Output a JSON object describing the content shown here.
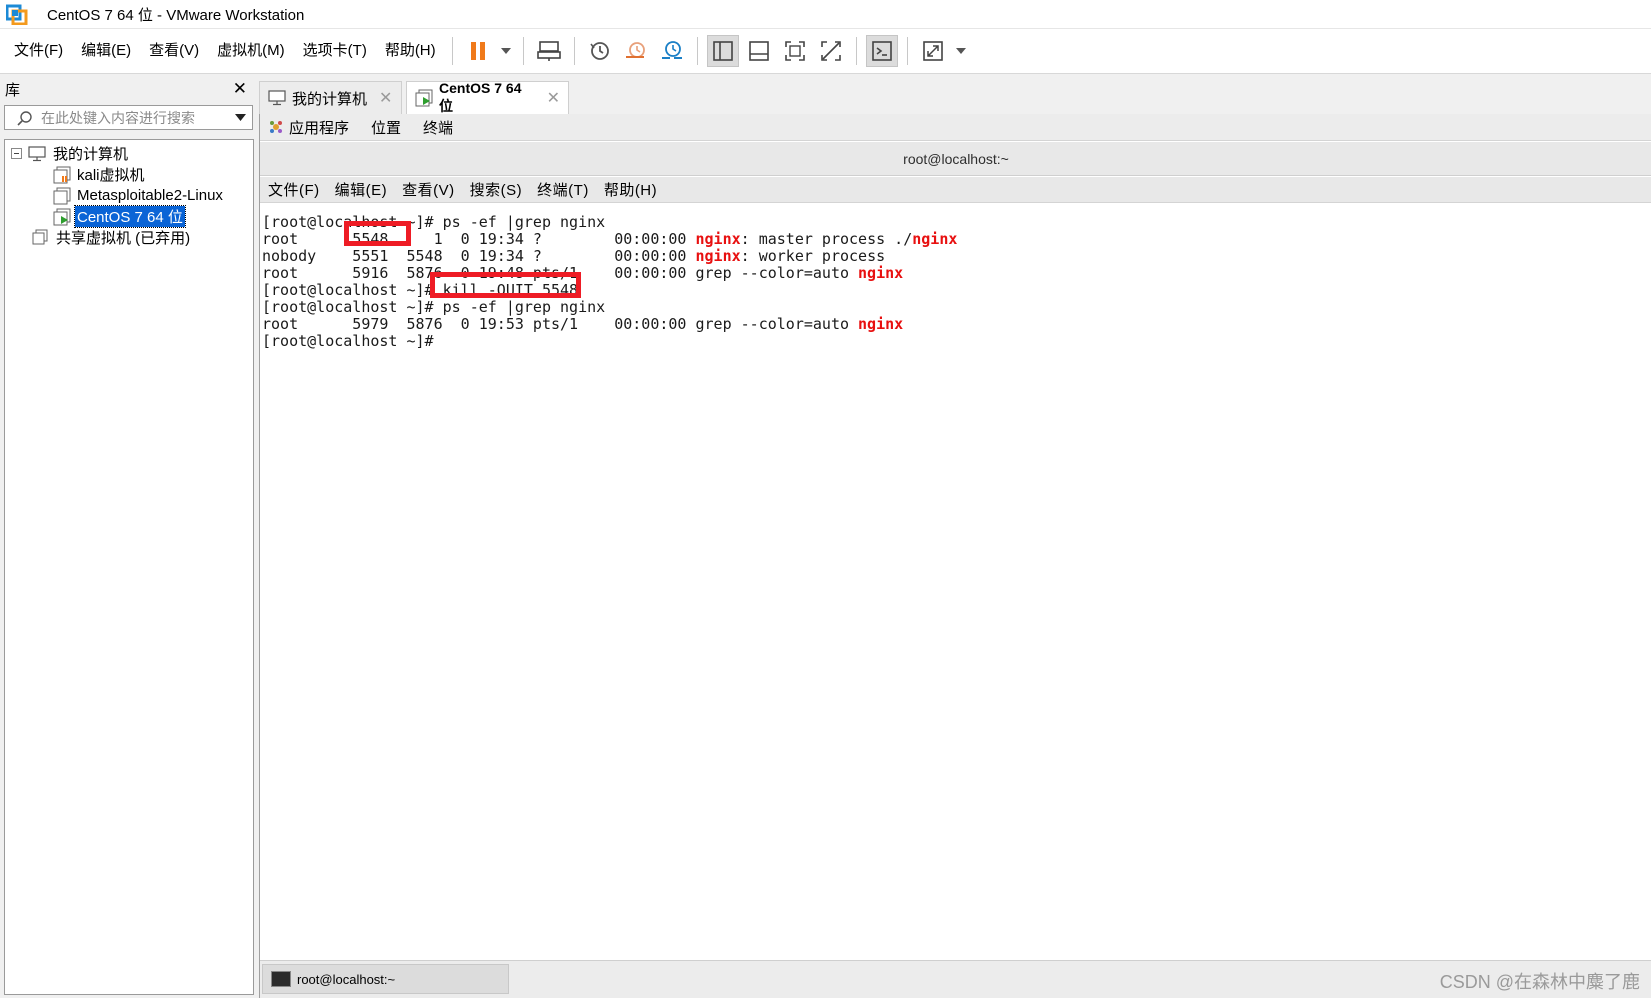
{
  "window": {
    "title": "CentOS 7 64 位 - VMware Workstation"
  },
  "menubar": {
    "items": [
      "文件(F)",
      "编辑(E)",
      "查看(V)",
      "虚拟机(M)",
      "选项卡(T)",
      "帮助(H)"
    ],
    "toolbar_icons": [
      "pause-icon",
      "dropdown-arrow-icon",
      "send-ctrl-alt-del-icon",
      "snapshot-icon",
      "revert-snapshot-icon",
      "snapshot-manager-icon",
      "library-view-icon",
      "thumbnail-bar-icon",
      "fullscreen-icon",
      "unity-icon",
      "console-view-icon",
      "stretch-icon",
      "dropdown-arrow-icon"
    ]
  },
  "library": {
    "title": "库",
    "search_placeholder": "在此处键入内容进行搜索",
    "items": [
      {
        "label": "我的计算机",
        "icon": "computer-icon"
      },
      {
        "label": "kali虚拟机",
        "icon": "vm-icon"
      },
      {
        "label": "Metasploitable2-Linux",
        "icon": "vm-icon"
      },
      {
        "label": "CentOS 7 64 位",
        "icon": "vm-running-icon",
        "selected": true
      },
      {
        "label": "共享虚拟机 (已弃用)",
        "icon": "shared-vm-icon"
      }
    ]
  },
  "tabs": [
    {
      "label": "我的计算机",
      "icon": "computer-icon",
      "active": false
    },
    {
      "label": "CentOS 7 64 位",
      "icon": "vm-running-icon",
      "active": true
    }
  ],
  "gnome": {
    "items": [
      "应用程序",
      "位置",
      "终端"
    ]
  },
  "terminal": {
    "title": "root@localhost:~",
    "menu": [
      "文件(F)",
      "编辑(E)",
      "查看(V)",
      "搜索(S)",
      "终端(T)",
      "帮助(H)"
    ],
    "lines": [
      {
        "segments": [
          {
            "t": "[root@localhost ~]# ps -ef |grep nginx"
          }
        ]
      },
      {
        "segments": [
          {
            "t": "root      5548     1  0 19:34 ?        00:00:00 "
          },
          {
            "t": "nginx",
            "red": true
          },
          {
            "t": ": master process ./"
          },
          {
            "t": "nginx",
            "red": true
          }
        ]
      },
      {
        "segments": [
          {
            "t": "nobody    5551  5548  0 19:34 ?        00:00:00 "
          },
          {
            "t": "nginx",
            "red": true
          },
          {
            "t": ": worker process"
          }
        ]
      },
      {
        "segments": [
          {
            "t": "root      5916  5876  0 19:48 pts/1    00:00:00 grep --color=auto "
          },
          {
            "t": "nginx",
            "red": true
          }
        ]
      },
      {
        "segments": [
          {
            "t": "[root@localhost ~]# kill -QUIT 5548"
          }
        ]
      },
      {
        "segments": [
          {
            "t": "[root@localhost ~]# ps -ef |grep nginx"
          }
        ]
      },
      {
        "segments": [
          {
            "t": "root      5979  5876  0 19:53 pts/1    00:00:00 grep --color=auto "
          },
          {
            "t": "nginx",
            "red": true
          }
        ]
      },
      {
        "segments": [
          {
            "t": "[root@localhost ~]# "
          }
        ]
      }
    ]
  },
  "taskbar": {
    "item_label": "root@localhost:~"
  },
  "watermark": "CSDN @在森林中麋了鹿",
  "colors": {
    "highlight_box": "#ee1c25",
    "nginx_text": "#e81010",
    "selection": "#0a64d6",
    "pause_orange": "#f07a1a"
  }
}
